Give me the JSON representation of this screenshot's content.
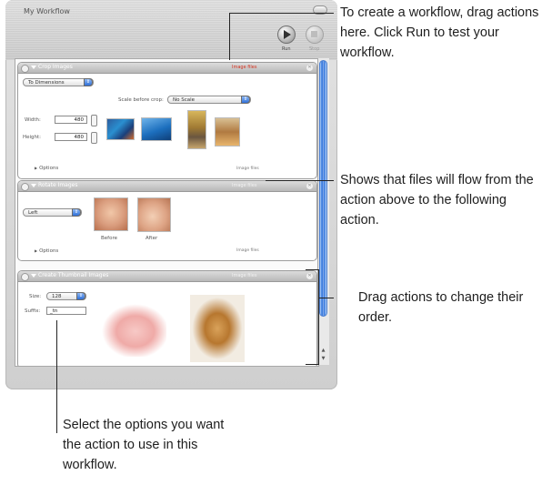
{
  "window": {
    "title": "My Workflow"
  },
  "toolbar": {
    "run_label": "Run",
    "stop_label": "Stop"
  },
  "actions": [
    {
      "title": "Crop Images",
      "tag": "Image files",
      "mode_value": "To Dimensions",
      "scale_label": "Scale before crop:",
      "scale_value": "No Scale",
      "width_label": "Width:",
      "width_value": "480",
      "height_label": "Height:",
      "height_value": "480",
      "options_label": "Options",
      "output_label": "Image files"
    },
    {
      "title": "Rotate Images",
      "tag": "Image files",
      "direction_value": "Left",
      "before_label": "Before",
      "after_label": "After",
      "options_label": "Options",
      "output_label": "Image files"
    },
    {
      "title": "Create Thumbnail Images",
      "tag": "Image files",
      "size_label": "Size:",
      "size_value": "128",
      "suffix_label": "Suffix:",
      "suffix_value": "_tn"
    }
  ],
  "callouts": {
    "drag_here": "To create a workflow, drag actions here. Click Run to test your workflow.",
    "flow": "Shows that files will flow from the action above to the following action.",
    "order": "Drag actions to change their order.",
    "options": "Select the options you want the action to use in this workflow."
  }
}
